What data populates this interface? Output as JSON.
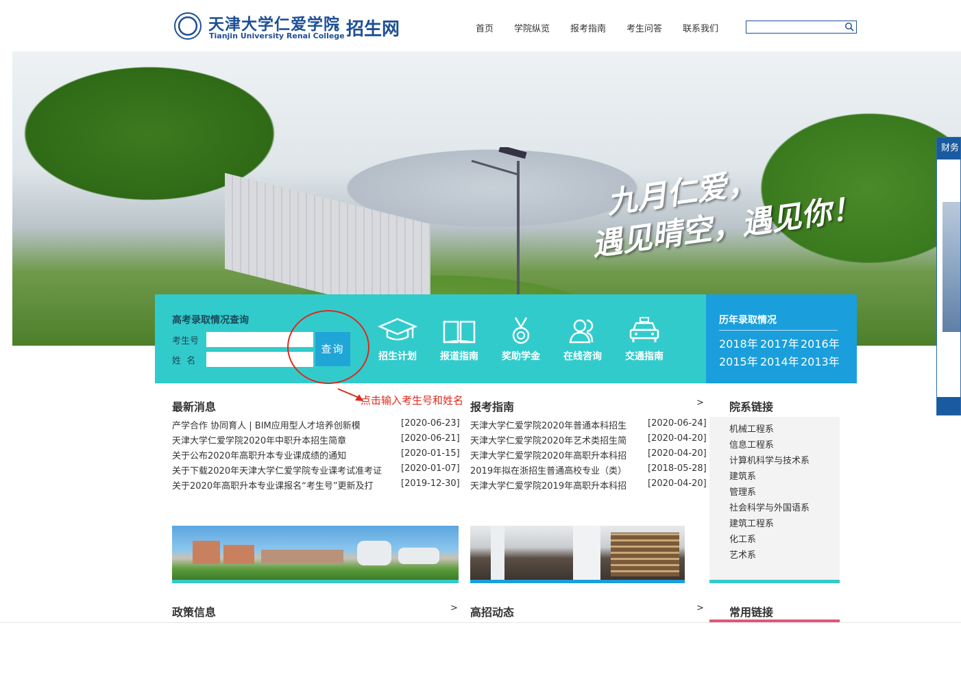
{
  "header": {
    "logo_cn": "天津大学仁爱学院",
    "logo_en": "Tianjin University Renai College",
    "logo_dot": "·",
    "site_name": "招生网",
    "nav": [
      "首页",
      "学院纵览",
      "报考指南",
      "考生问答",
      "联系我们"
    ],
    "search_placeholder": ""
  },
  "banner": {
    "slogan_line1": "九月仁爱，",
    "slogan_line2": "遇见晴空，遇见你！"
  },
  "side_widget": {
    "title": "财务"
  },
  "query": {
    "title": "高考录取情况查询",
    "id_label": "考生号",
    "name_label": "姓  名",
    "id_value": "",
    "name_value": "",
    "button": "查询"
  },
  "quick_links": [
    {
      "label": "招生计划",
      "icon": "graduation-cap-icon"
    },
    {
      "label": "报道指南",
      "icon": "book-icon"
    },
    {
      "label": "奖助学金",
      "icon": "medal-icon"
    },
    {
      "label": "在线咨询",
      "icon": "users-icon"
    },
    {
      "label": "交通指南",
      "icon": "car-icon"
    }
  ],
  "history": {
    "title": "历年录取情况",
    "years_row1": [
      "2018年",
      "2017年",
      "2016年"
    ],
    "years_row2": [
      "2015年",
      "2014年",
      "2013年"
    ]
  },
  "annotation": {
    "text": "点击输入考生号和姓名"
  },
  "latest_news": {
    "title": "最新消息",
    "items": [
      {
        "title": "产学合作 协同育人 | BIM应用型人才培养创新模",
        "date": "[2020-06-23]"
      },
      {
        "title": "天津大学仁爱学院2020年中职升本招生简章",
        "date": "[2020-06-21]"
      },
      {
        "title": "关于公布2020年高职升本专业课成绩的通知",
        "date": "[2020-01-15]"
      },
      {
        "title": "关于下载2020年天津大学仁爱学院专业课考试准考证",
        "date": "[2020-01-07]"
      },
      {
        "title": "关于2020年高职升本专业课报名“考生号”更新及打",
        "date": "[2019-12-30]"
      }
    ]
  },
  "guide": {
    "title": "报考指南",
    "more": ">",
    "items": [
      {
        "title": "天津大学仁爱学院2020年普通本科招生",
        "date": "[2020-06-24]"
      },
      {
        "title": "天津大学仁爱学院2020年艺术类招生简",
        "date": "[2020-04-20]"
      },
      {
        "title": "天津大学仁爱学院2020年高职升本科招",
        "date": "[2020-04-20]"
      },
      {
        "title": "2019年拟在浙招生普通高校专业（类）",
        "date": "[2018-05-28]"
      },
      {
        "title": "天津大学仁爱学院2019年高职升本科招",
        "date": "[2020-04-20]"
      }
    ]
  },
  "departments": {
    "title": "院系链接",
    "items": [
      "机械工程系",
      "信息工程系",
      "计算机科学与技术系",
      "建筑系",
      "管理系",
      "社会科学与外国语系",
      "建筑工程系",
      "化工系",
      "艺术系"
    ]
  },
  "bottom_sections": {
    "policy": "政策信息",
    "policy_more": ">",
    "enroll": "高招动态",
    "enroll_more": ">",
    "common_links": "常用链接"
  },
  "colors": {
    "brand": "#1d4f95",
    "teal": "#32cbcb",
    "blue": "#1a9fdc",
    "annotation": "#e0281b"
  }
}
